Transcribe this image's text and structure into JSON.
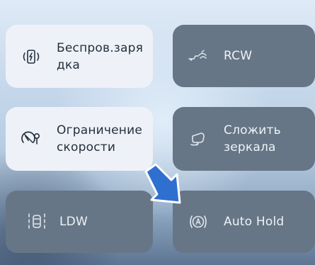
{
  "tiles": {
    "wireless_charging": {
      "label": "Беспров.заря\nдка",
      "icon": "wireless-charging-icon",
      "state": "on"
    },
    "rcw": {
      "label": "RCW",
      "icon": "rcw-icon",
      "state": "off"
    },
    "speed_limit": {
      "label": "Ограничение\nскорости",
      "icon": "speed-limit-icon",
      "state": "on"
    },
    "fold_mirrors": {
      "label": "Сложить\nзеркала",
      "icon": "mirror-icon",
      "state": "off"
    },
    "ldw": {
      "label": "LDW",
      "icon": "lane-departure-icon",
      "state": "off"
    },
    "auto_hold": {
      "label": "Auto Hold",
      "icon": "auto-hold-icon",
      "state": "off"
    }
  },
  "colors": {
    "tile_on": "#eef2f8",
    "tile_off": "#667686",
    "arrow": "#2f6fd0"
  }
}
